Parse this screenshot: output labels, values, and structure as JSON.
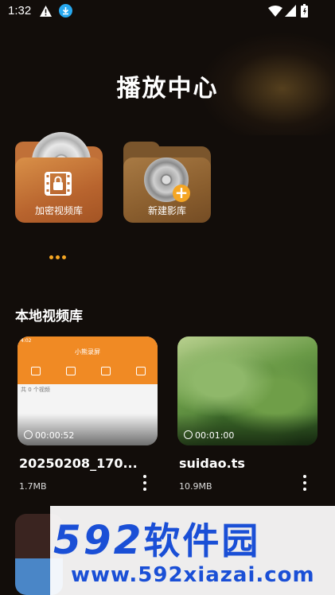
{
  "status_bar": {
    "time": "1:32"
  },
  "header": {
    "title": "播放中心"
  },
  "libraries": [
    {
      "label": "加密视频库"
    },
    {
      "label": "新建影库"
    }
  ],
  "section": {
    "title": "本地视频库"
  },
  "videos": [
    {
      "name": "20250208_170...",
      "size": "1.7MB",
      "duration": "00:00:52",
      "thumb_text": "小熊录屏",
      "thumb_subtext": "共 0 个视频"
    },
    {
      "name": "suidao.ts",
      "size": "10.9MB",
      "duration": "00:01:00"
    }
  ],
  "watermark": {
    "logo_num": "592",
    "logo_cn": "软件园",
    "url": "www.592xiazai.com"
  },
  "colors": {
    "accent": "#f5a623",
    "background": "#120d0a",
    "watermark_blue": "#1a4fd6"
  }
}
